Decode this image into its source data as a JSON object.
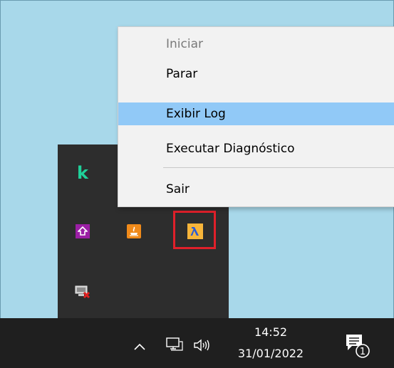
{
  "context_menu": {
    "items": [
      {
        "label": "Iniciar",
        "state": "disabled"
      },
      {
        "label": "Parar",
        "state": "normal"
      },
      {
        "label": "Exibir Log",
        "state": "hover"
      },
      {
        "label": "Executar Diagnóstico",
        "state": "normal"
      },
      {
        "label": "Sair",
        "state": "normal"
      }
    ]
  },
  "tray_overflow": {
    "icons": [
      "kaspersky-k-icon",
      "purple-app-icon",
      "java-icon",
      "lambda-app-icon",
      "network-error-icon"
    ],
    "k_glyph": "k",
    "highlighted_icon": "lambda-app-icon",
    "highlight_color": "#e0202a"
  },
  "taskbar": {
    "time": "14:52",
    "date": "31/01/2022",
    "notification_count": "1",
    "icons": [
      "chevron-up-icon",
      "network-monitor-icon",
      "volume-icon",
      "action-center-icon"
    ]
  },
  "colors": {
    "desktop": "#a8d8ea",
    "menu_bg": "#f2f2f2",
    "menu_hover": "#91c9f7",
    "taskbar_bg": "#1f1f1f",
    "tray_bg": "#2d2d2d"
  }
}
